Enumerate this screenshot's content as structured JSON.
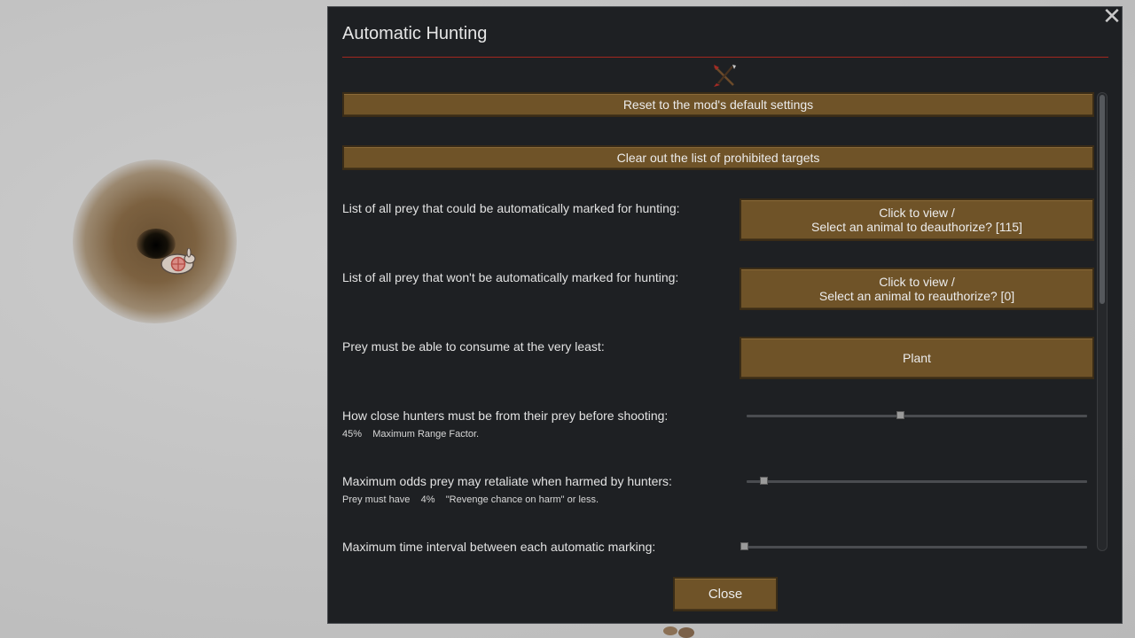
{
  "window": {
    "title": "Automatic Hunting",
    "close_x": "✕"
  },
  "buttons": {
    "reset": "Reset to the mod's default settings",
    "clear_prohibited": "Clear out the list of prohibited targets",
    "close": "Close"
  },
  "settings": {
    "huntable_list": {
      "label": "List of all prey that could be automatically marked for hunting:",
      "button_line1": "Click to view    /",
      "button_line2": "Select an animal to deauthorize?    [115]"
    },
    "prohibited_list": {
      "label": "List of all prey that won't be automatically marked for hunting:",
      "button_line1": "Click to view    /",
      "button_line2": "Select an animal to reauthorize?    [0]"
    },
    "min_diet": {
      "label": "Prey must be able to consume at the very least:",
      "value": "Plant"
    },
    "range": {
      "label": "How close hunters must be from their prey before shooting:",
      "sub": "45%    Maximum Range Factor.",
      "slider_fraction": 0.45
    },
    "revenge": {
      "label": "Maximum odds prey may retaliate when harmed by hunters:",
      "sub": "Prey must have    4%    \"Revenge chance on harm\" or less.",
      "slider_fraction": 0.04
    },
    "interval": {
      "label": "Maximum time interval between each automatic marking:",
      "slider_fraction": 0.0
    }
  },
  "icons": {
    "mod_icon": "crossed-spear-arrow-icon",
    "rabbit": "rabbit-icon"
  },
  "colors": {
    "dialog_bg": "#1e2023",
    "button_bg": "#6f5328",
    "title_rule": "#a4271f"
  }
}
